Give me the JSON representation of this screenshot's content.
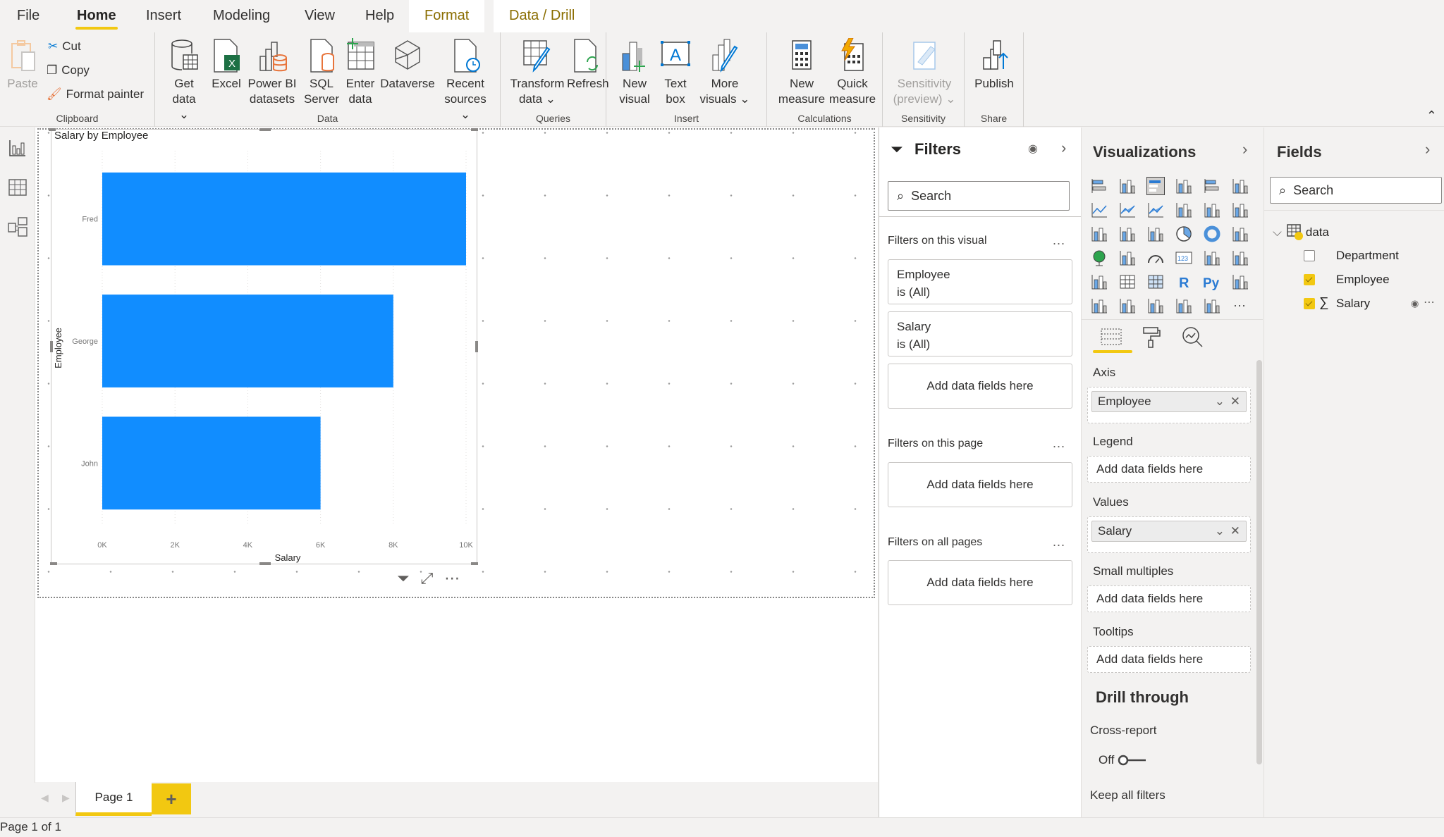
{
  "tabs": [
    {
      "label": "File",
      "active": false
    },
    {
      "label": "Home",
      "active": true
    },
    {
      "label": "Insert",
      "active": false
    },
    {
      "label": "Modeling",
      "active": false
    },
    {
      "label": "View",
      "active": false
    },
    {
      "label": "Help",
      "active": false
    },
    {
      "label": "Format",
      "active": false,
      "contextual": true
    },
    {
      "label": "Data / Drill",
      "active": false,
      "contextual": true
    }
  ],
  "ribbon": {
    "clipboard": {
      "label": "Clipboard",
      "paste": "Paste",
      "cut": "Cut",
      "copy": "Copy",
      "format_painter": "Format painter"
    },
    "data": {
      "label": "Data",
      "get_data": [
        "Get",
        "data"
      ],
      "excel": "Excel",
      "pbi_datasets": [
        "Power BI",
        "datasets"
      ],
      "sql_server": [
        "SQL",
        "Server"
      ],
      "enter_data": [
        "Enter",
        "data"
      ],
      "dataverse": "Dataverse",
      "recent_sources": [
        "Recent",
        "sources"
      ]
    },
    "queries": {
      "label": "Queries",
      "transform_data": [
        "Transform",
        "data"
      ],
      "refresh": "Refresh"
    },
    "insert": {
      "label": "Insert",
      "new_visual": [
        "New",
        "visual"
      ],
      "text_box": [
        "Text",
        "box"
      ],
      "more_visuals": [
        "More",
        "visuals"
      ]
    },
    "calculations": {
      "label": "Calculations",
      "new_measure": [
        "New",
        "measure"
      ],
      "quick_measure": [
        "Quick",
        "measure"
      ]
    },
    "sensitivity": {
      "label": "Sensitivity",
      "sensitivity": [
        "Sensitivity",
        "(preview)"
      ]
    },
    "share": {
      "label": "Share",
      "publish": "Publish"
    }
  },
  "visual": {
    "title": "Salary by Employee",
    "bar_color": "#118dff"
  },
  "chart_data": {
    "type": "bar",
    "orientation": "horizontal",
    "title": "Salary by Employee",
    "categories": [
      "Fred",
      "George",
      "John"
    ],
    "values": [
      10000,
      8000,
      6000
    ],
    "xlabel": "Salary",
    "ylabel": "Employee",
    "xlim": [
      0,
      10000
    ],
    "xticks": [
      "0K",
      "2K",
      "4K",
      "6K",
      "8K",
      "10K"
    ],
    "grid": true,
    "legend": "none"
  },
  "pages": {
    "tabs": [
      "Page 1"
    ],
    "active": "Page 1",
    "add_label": "+",
    "status": "Page 1 of 1"
  },
  "filters": {
    "title": "Filters",
    "search_placeholder": "Search",
    "on_visual_label": "Filters on this visual",
    "visual_filters": [
      {
        "field": "Employee",
        "state": "is (All)"
      },
      {
        "field": "Salary",
        "state": "is (All)"
      }
    ],
    "add_fields": "Add data fields here",
    "on_page_label": "Filters on this page",
    "on_all_label": "Filters on all pages",
    "more": "..."
  },
  "visualizations": {
    "title": "Visualizations",
    "wells": [
      {
        "label": "Axis",
        "value": "Employee"
      },
      {
        "label": "Legend",
        "value": null
      },
      {
        "label": "Values",
        "value": "Salary"
      },
      {
        "label": "Small multiples",
        "value": null
      },
      {
        "label": "Tooltips",
        "value": null
      }
    ],
    "add_fields": "Add data fields here",
    "drill_through": "Drill through",
    "cross_report": "Cross-report",
    "toggle_state": "Off",
    "keep_all_filters": "Keep all filters"
  },
  "fields": {
    "title": "Fields",
    "search_placeholder": "Search",
    "table": "data",
    "items": [
      {
        "name": "Department",
        "checked": false,
        "measure": false
      },
      {
        "name": "Employee",
        "checked": true,
        "measure": false
      },
      {
        "name": "Salary",
        "checked": true,
        "measure": true
      }
    ]
  },
  "colors": {
    "accent": "#f2c811",
    "bar": "#118dff",
    "format_tab": "#8a6d00"
  }
}
